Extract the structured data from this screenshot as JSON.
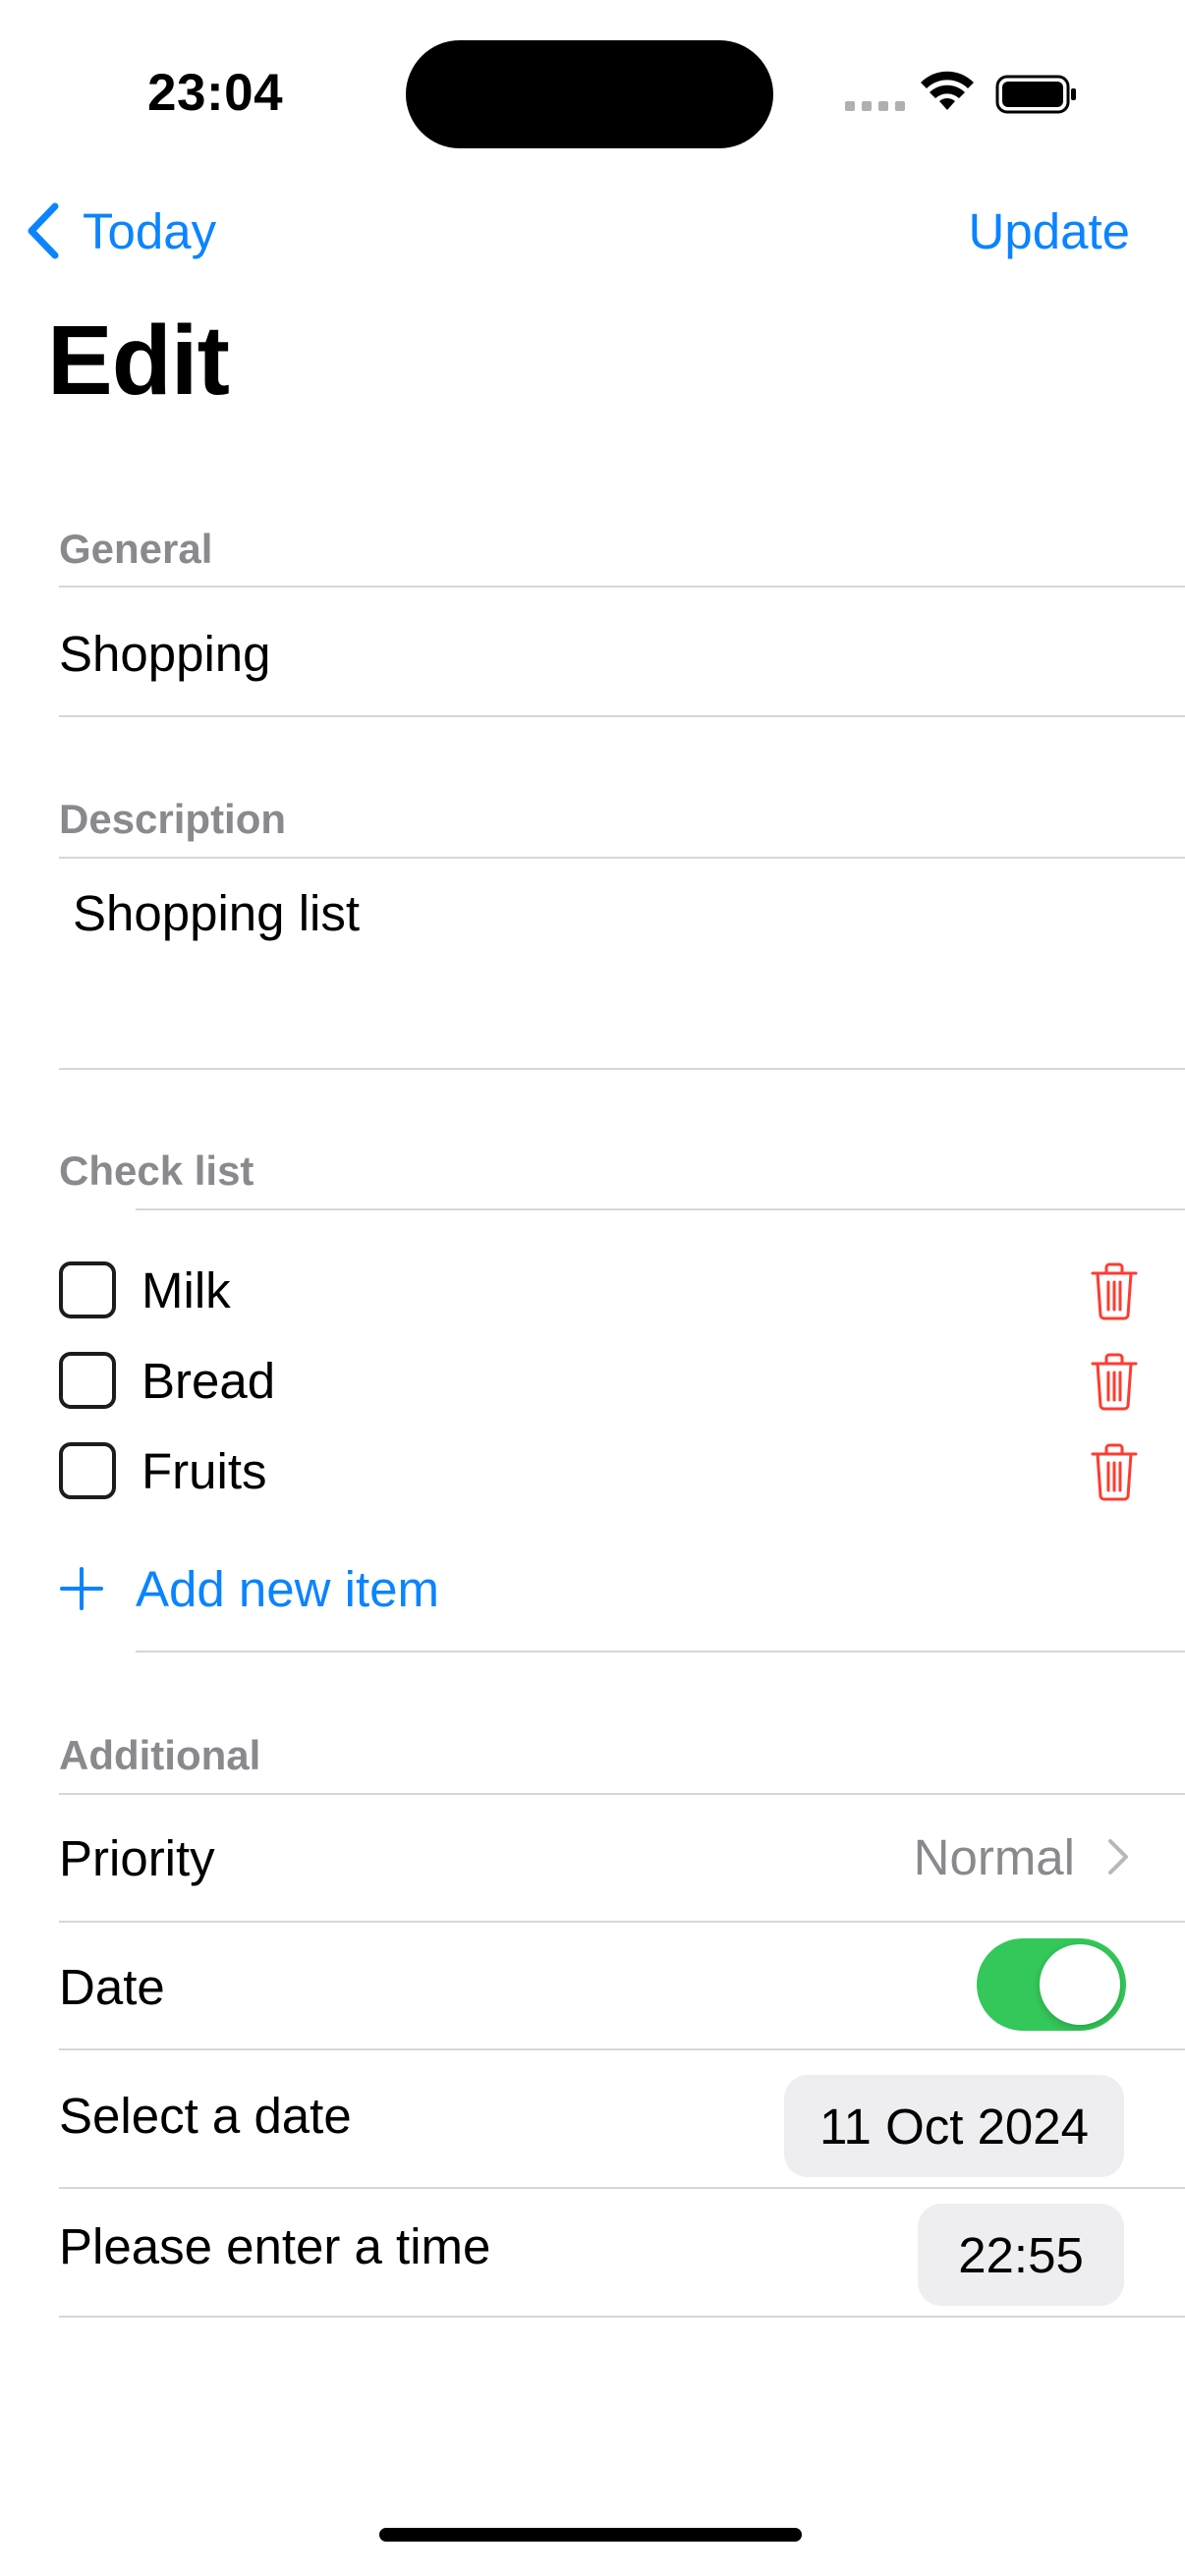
{
  "status_bar": {
    "time": "23:04"
  },
  "nav": {
    "back_label": "Today",
    "action_label": "Update",
    "title": "Edit"
  },
  "general": {
    "header": "General",
    "value": "Shopping"
  },
  "description": {
    "header": "Description",
    "value": "Shopping list"
  },
  "checklist": {
    "header": "Check list",
    "items": [
      {
        "label": "Milk",
        "checked": false
      },
      {
        "label": "Bread",
        "checked": false
      },
      {
        "label": "Fruits",
        "checked": false
      }
    ],
    "add_label": "Add new item"
  },
  "additional": {
    "header": "Additional",
    "priority_label": "Priority",
    "priority_value": "Normal",
    "date_label": "Date",
    "date_toggle_on": true,
    "select_date_label": "Select a date",
    "date_value": "11 Oct 2024",
    "time_label": "Please enter a time",
    "time_value": "22:55"
  },
  "colors": {
    "accent": "#0a84ff",
    "toggle_on": "#34c759",
    "destructive": "#ff3b30",
    "secondary_text": "#8a8a8e"
  },
  "icons": [
    "chevron-left-icon",
    "trash-icon",
    "plus-icon",
    "chevron-right-icon",
    "wifi-icon",
    "battery-icon"
  ]
}
